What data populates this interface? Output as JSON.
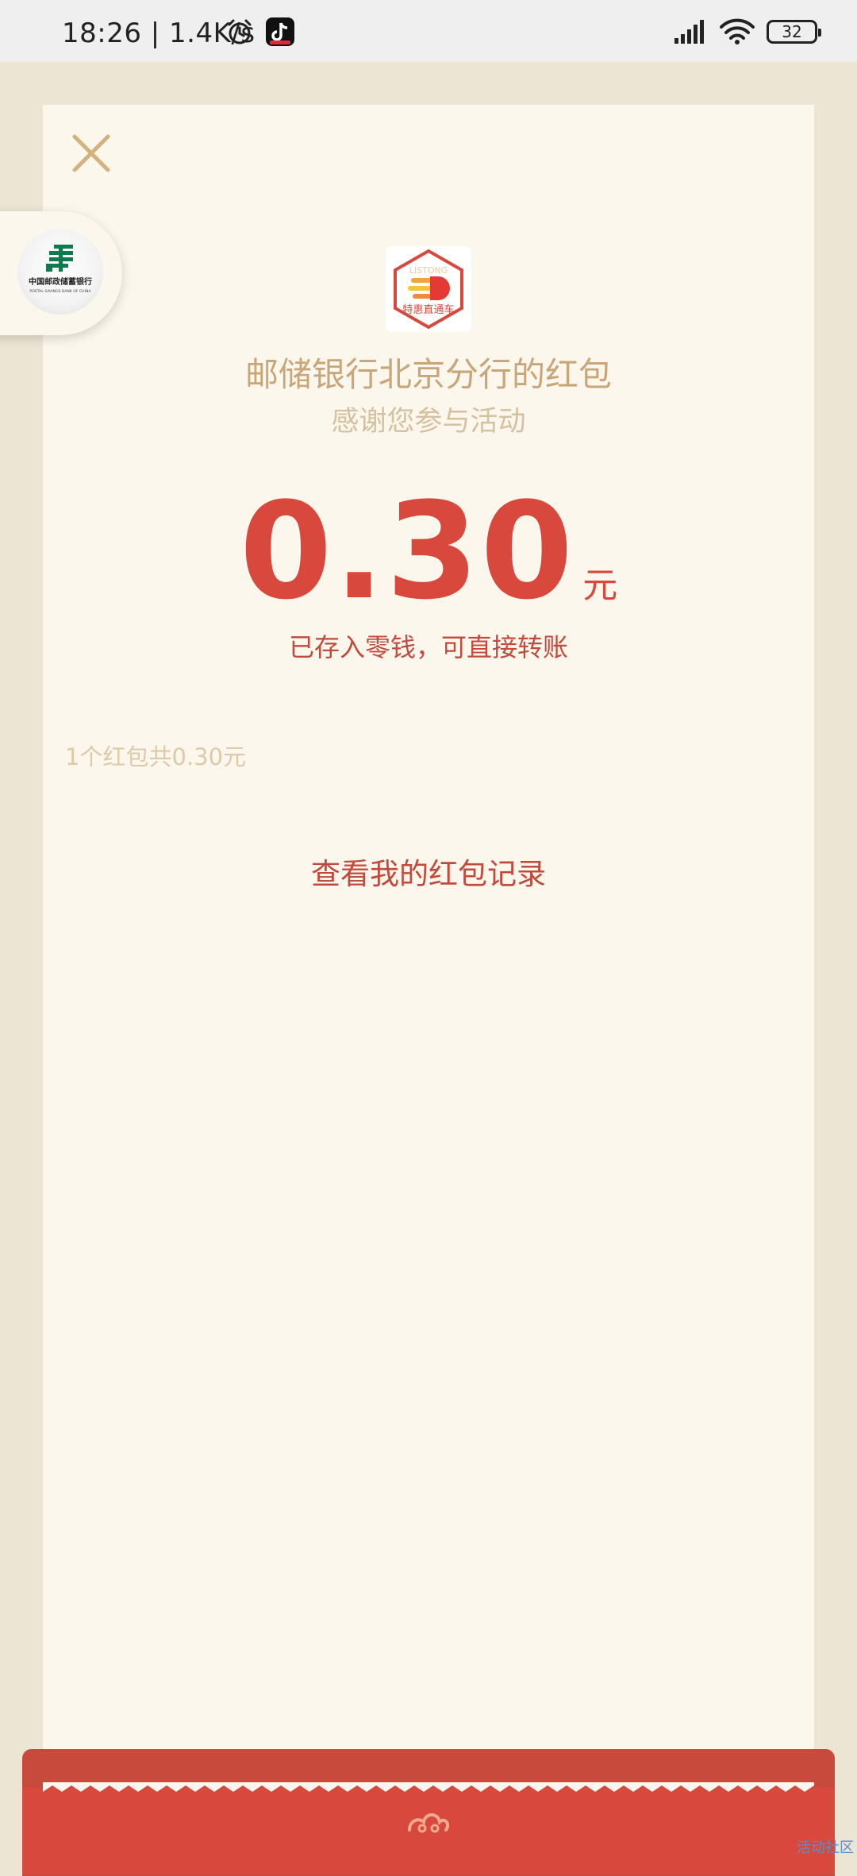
{
  "status_bar": {
    "time": "18:26 | 1.4K/s",
    "battery": "32"
  },
  "red_packet": {
    "app_name_line1": "LISTONG",
    "app_name_line2": "特惠直通车",
    "sender": "邮储银行北京分行的红包",
    "greeting": "感谢您参与活动",
    "amount": "0.30",
    "currency": "元",
    "deposit_note": "已存入零钱，可直接转账",
    "summary": "1个红包共0.30元",
    "record_link": "查看我的红包记录"
  },
  "bank_logo": {
    "line1": "中国邮政储蓄银行",
    "line2": "POSTAL SAVINGS BANK OF CHINA"
  },
  "watermark": "活动社区",
  "colors": {
    "accent_red": "#d8483c",
    "gold": "#c8a679",
    "card_bg": "#fbf7ed",
    "page_bg": "#ede5d3"
  }
}
